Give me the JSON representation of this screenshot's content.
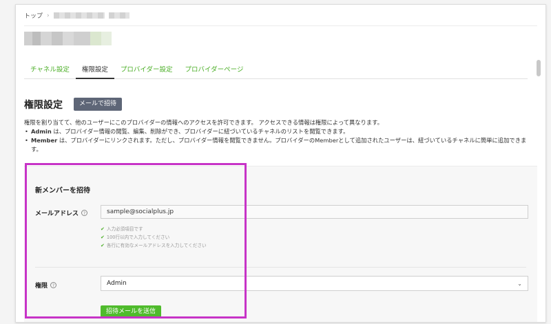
{
  "breadcrumb": {
    "home": "トップ",
    "separator": "›"
  },
  "tabs": [
    {
      "label": "チャネル設定",
      "active": false
    },
    {
      "label": "権限設定",
      "active": true
    },
    {
      "label": "プロバイダー設定",
      "active": false
    },
    {
      "label": "プロバイダーページ",
      "active": false
    }
  ],
  "section": {
    "title": "権限設定",
    "invite_button": "メールで招待",
    "description": "権限を割り当てて、他のユーザーにこのプロバイダーの情報へのアクセスを許可できます。 アクセスできる情報は権限によって異なります。",
    "admin_role": "Admin",
    "admin_text": " は、プロバイダー情報の閲覧、編集、削除ができ、プロバイダーに紐づいているチャネルのリストを閲覧できます。",
    "member_role": "Member",
    "member_text": " は、プロバイダーにリンクされます。ただし、プロバイダー情報を閲覧できません。プロバイダーのMemberとして追加されたユーザーは、紐づいているチャネルに簡単に追加できます。"
  },
  "invite_form": {
    "title": "新メンバーを招待",
    "email_label": "メールアドレス",
    "email_value": "sample@socialplus.jp",
    "hints": [
      "入力必須項目です",
      "100行以内で入力してください",
      "各行に有効なメールアドレスを入力してください"
    ],
    "role_label": "権限",
    "role_selected": "Admin",
    "submit_label": "招待メールを送信"
  },
  "icons": {
    "help": "?",
    "check": "✔",
    "chevron": "⌄"
  },
  "colors": {
    "accent_green": "#4fbb2c",
    "tab_green": "#4caf28",
    "highlight": "#c733c7",
    "mail_button": "#5e6677"
  }
}
